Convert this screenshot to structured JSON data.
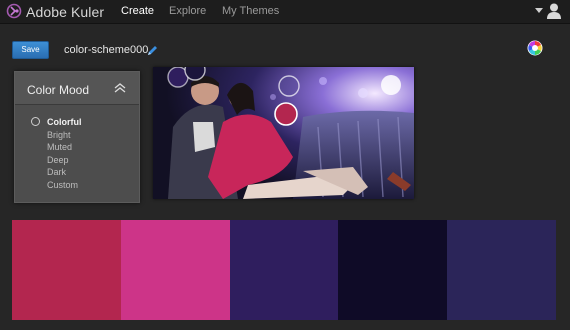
{
  "app": {
    "brand": "Adobe Kuler"
  },
  "nav": {
    "create": "Create",
    "explore": "Explore",
    "my_themes": "My Themes"
  },
  "toolbar": {
    "save_label": "Save",
    "scheme_name": "color-scheme000"
  },
  "mood_panel": {
    "title": "Color Mood",
    "items": [
      "Colorful",
      "Bright",
      "Muted",
      "Deep",
      "Dark",
      "Custom"
    ],
    "selected": "Colorful"
  },
  "icons": {
    "logo": "kuler-logo-icon",
    "edit": "pencil-icon",
    "user": "user-icon",
    "color_wheel": "color-wheel-icon",
    "collapse": "chevron-up-icon"
  },
  "swatches": [
    "#b3264f",
    "#cd3488",
    "#2f1e5e",
    "#0f0b27",
    "#2b2559"
  ],
  "colors": {
    "accent": "#2a7fd0",
    "topbar": "#1d1d1d",
    "background": "#262626"
  }
}
